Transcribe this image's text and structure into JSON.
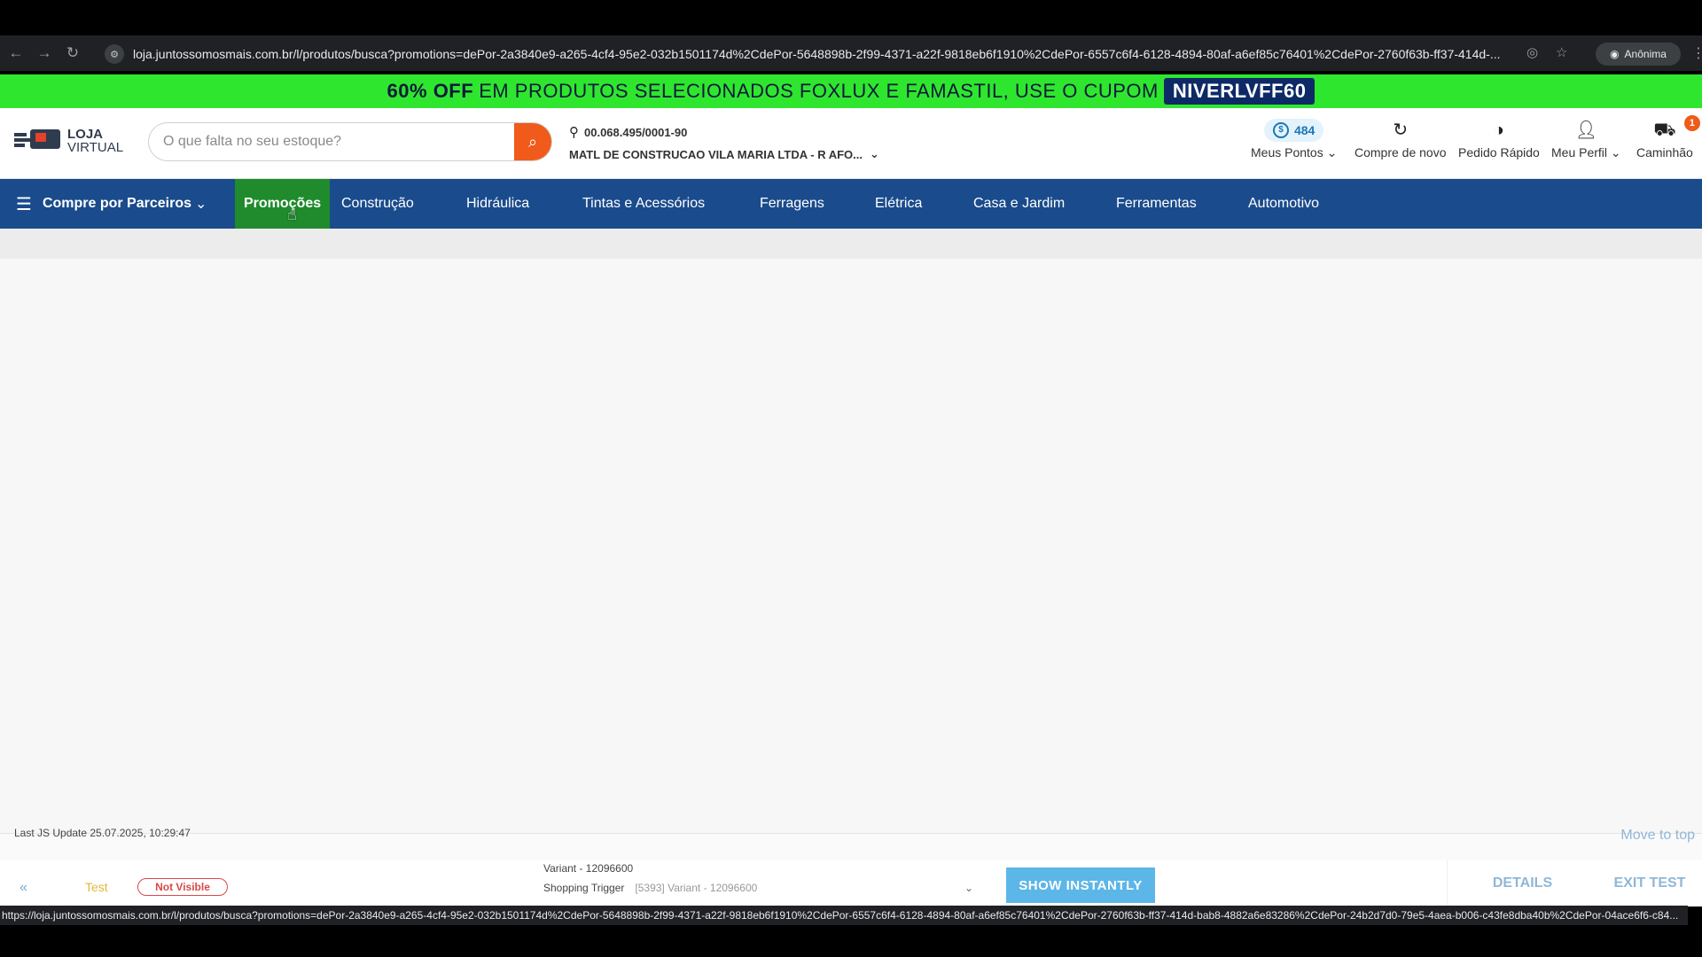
{
  "browser": {
    "url": "loja.juntossomosmais.com.br/l/produtos/busca?promotions=dePor-2a3840e9-a265-4cf4-95e2-032b1501174d%2CdePor-5648898b-2f99-4371-a22f-9818eb6f1910%2CdePor-6557c6f4-6128-4894-80af-a6ef85c76401%2CdePor-2760f63b-ff37-414d-...",
    "incognito_label": "Anônima",
    "status_url": "https://loja.juntossomosmais.com.br/l/produtos/busca?promotions=dePor-2a3840e9-a265-4cf4-95e2-032b1501174d%2CdePor-5648898b-2f99-4371-a22f-9818eb6f1910%2CdePor-6557c6f4-6128-4894-80af-a6ef85c76401%2CdePor-2760f63b-ff37-414d-bab8-4882a6e83286%2CdePor-24b2d7d0-79e5-4aea-b006-c43fe8dba40b%2CdePor-04ace6f6-c84..."
  },
  "promo": {
    "bold": "60% OFF",
    "text": "EM PRODUTOS SELECIONADOS FOXLUX E FAMASTIL, USE O CUPOM",
    "coupon": "NIVERLVFF60"
  },
  "header": {
    "logo_line1": "LOJA",
    "logo_line2": "VIRTUAL",
    "search_placeholder": "O que falta no seu estoque?",
    "cnpj": "00.068.495/0001-90",
    "store_name": "MATL DE CONSTRUCAO VILA MARIA LTDA - R AFO...",
    "points_value": "484",
    "points_label": "Meus Pontos",
    "buy_again_label": "Compre de novo",
    "quick_order_label": "Pedido Rápido",
    "profile_label": "Meu Perfil",
    "cart_label": "Caminhão",
    "cart_count": "1"
  },
  "menu": {
    "partners": "Compre por Parceiros",
    "items": [
      "Promoções",
      "Construção",
      "Hidráulica",
      "Tintas e Acessórios",
      "Ferragens",
      "Elétrica",
      "Casa e Jardim",
      "Ferramentas",
      "Automotivo"
    ]
  },
  "overlay": {
    "last_update": "Last JS Update 25.07.2025, 10:29:47",
    "move_top": "Move to top",
    "test_label": "Test",
    "not_visible": "Not Visible",
    "variant": "Variant - 12096600",
    "trigger_label": "Shopping Trigger",
    "trigger_value": "[5393] Variant - 12096600",
    "show_instantly": "SHOW INSTANTLY",
    "details": "DETAILS",
    "exit_test": "EXIT TEST"
  },
  "colors": {
    "promo_bg": "#2fe62f",
    "menu_bg": "#1a4b8c",
    "active_menu_bg": "#1f8b2d",
    "search_button": "#f05a1a"
  }
}
